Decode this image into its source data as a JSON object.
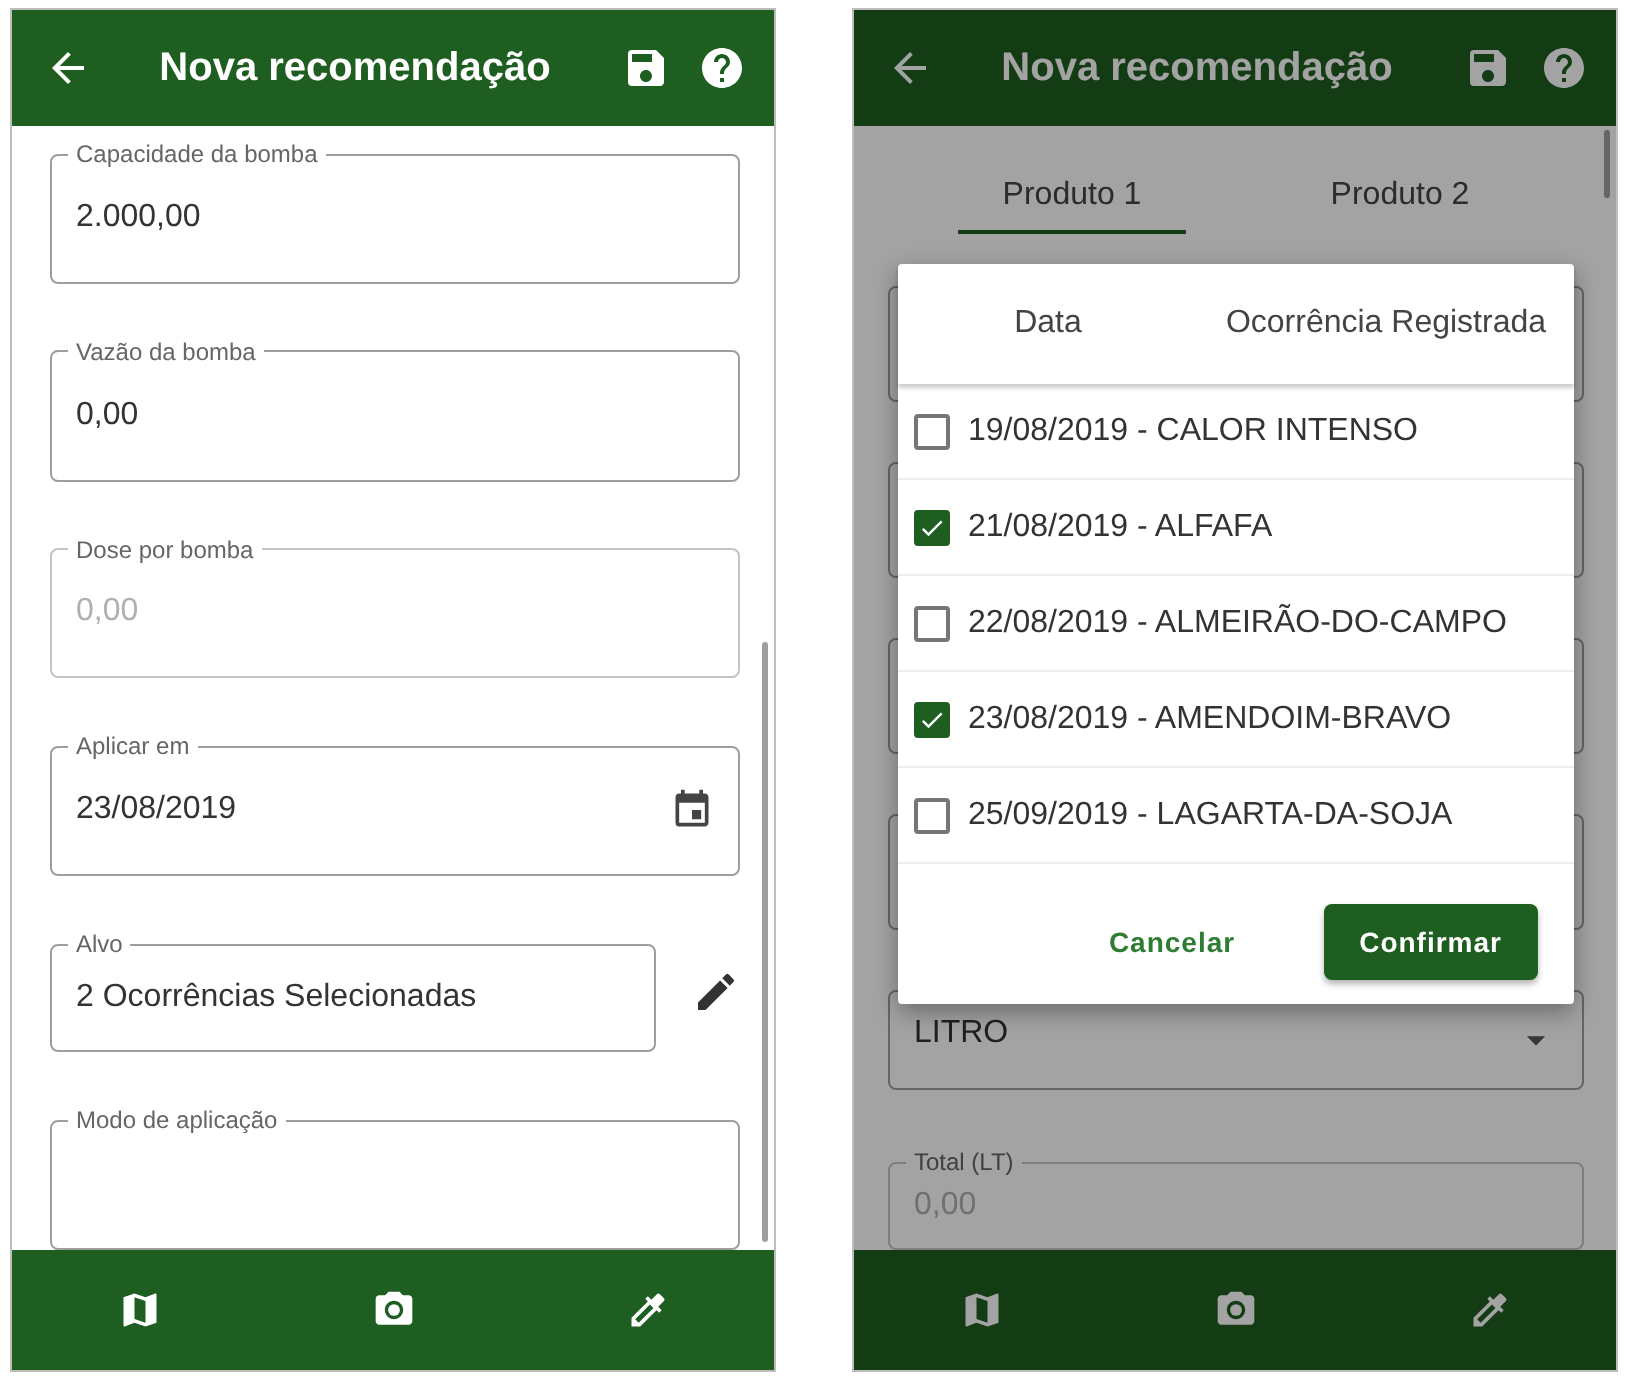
{
  "left_screen": {
    "title": "Nova recomendação",
    "fields": [
      {
        "kind": "text",
        "label": "Capacidade da bomba",
        "value": "2.000,00",
        "disabled": false
      },
      {
        "kind": "text",
        "label": "Vazão da bomba",
        "value": "0,00",
        "disabled": false
      },
      {
        "kind": "text",
        "label": "Dose por bomba",
        "value": "0,00",
        "disabled": true
      },
      {
        "kind": "date",
        "label": "Aplicar em",
        "value": "23/08/2019",
        "disabled": false
      },
      {
        "kind": "edit",
        "label": "Alvo",
        "value": "2 Ocorrências Selecionadas",
        "disabled": false
      },
      {
        "kind": "multiline",
        "label": "Modo de aplicação",
        "disabled": false
      }
    ]
  },
  "right_screen": {
    "title": "Nova recomendação",
    "tabs": [
      {
        "label": "Produto 1",
        "selected": true
      },
      {
        "label": "Produto 2",
        "selected": false
      }
    ],
    "fields": [
      {
        "kind": "select",
        "value": "LITRO",
        "disabled": false
      },
      {
        "kind": "text",
        "label": "Total (LT)",
        "value": "0,00",
        "disabled": true
      }
    ],
    "dialog": {
      "columns": [
        "Data",
        "Ocorrência Registrada"
      ],
      "items": [
        {
          "label": "19/08/2019 - CALOR INTENSO",
          "checked": false
        },
        {
          "label": "21/08/2019 - ALFAFA",
          "checked": true
        },
        {
          "label": "22/08/2019 - ALMEIRÃO-DO-CAMPO",
          "checked": false
        },
        {
          "label": "23/08/2019 - AMENDOIM-BRAVO",
          "checked": true
        },
        {
          "label": "25/09/2019 - LAGARTA-DA-SOJA",
          "checked": false
        }
      ],
      "buttons": [
        {
          "kind": "text",
          "label": "Cancelar"
        },
        {
          "kind": "primary",
          "label": "Confirmar"
        }
      ]
    }
  }
}
